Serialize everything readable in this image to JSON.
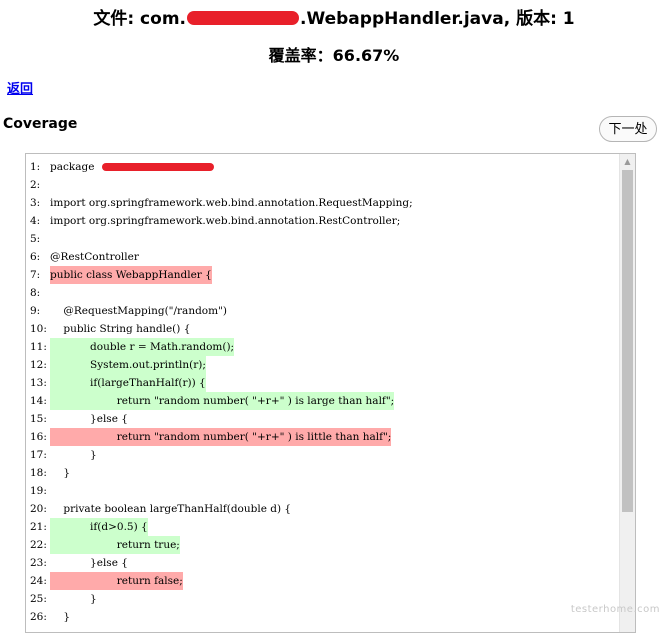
{
  "header": {
    "title_prefix": "文件: com.",
    "title_suffix": ".WebappHandler.java, 版本: 1",
    "coverage_text": "覆盖率：66.67%"
  },
  "nav": {
    "back_label": "返回"
  },
  "section": {
    "label": "Coverage"
  },
  "toolbar": {
    "next_label": "下一处"
  },
  "colors": {
    "hit": "#ccffcc",
    "miss": "#ffaaaa",
    "redaction": "#e8202a",
    "link": "#0000ee"
  },
  "code_lines": [
    {
      "num": "1:",
      "text": "package ",
      "status": "none",
      "redacted": true
    },
    {
      "num": "2:",
      "text": "",
      "status": "none"
    },
    {
      "num": "3:",
      "text": "import org.springframework.web.bind.annotation.RequestMapping;",
      "status": "none"
    },
    {
      "num": "4:",
      "text": "import org.springframework.web.bind.annotation.RestController;",
      "status": "none"
    },
    {
      "num": "5:",
      "text": "",
      "status": "none"
    },
    {
      "num": "6:",
      "text": "@RestController",
      "status": "none"
    },
    {
      "num": "7:",
      "text": "public class WebappHandler {",
      "status": "miss"
    },
    {
      "num": "8:",
      "text": "",
      "status": "none"
    },
    {
      "num": "9:",
      "text": "    @RequestMapping(\"/random\")",
      "status": "none"
    },
    {
      "num": "10:",
      "text": "    public String handle() {",
      "status": "none"
    },
    {
      "num": "11:",
      "text": "            double r = Math.random();",
      "status": "hit"
    },
    {
      "num": "12:",
      "text": "            System.out.println(r);",
      "status": "hit"
    },
    {
      "num": "13:",
      "text": "            if(largeThanHalf(r)) {",
      "status": "hit"
    },
    {
      "num": "14:",
      "text": "                    return \"random number( \"+r+\" ) is large than half\";",
      "status": "hit"
    },
    {
      "num": "15:",
      "text": "            }else {",
      "status": "none"
    },
    {
      "num": "16:",
      "text": "                    return \"random number( \"+r+\" ) is little than half\";",
      "status": "miss"
    },
    {
      "num": "17:",
      "text": "            }",
      "status": "none"
    },
    {
      "num": "18:",
      "text": "    }",
      "status": "none"
    },
    {
      "num": "19:",
      "text": "",
      "status": "none"
    },
    {
      "num": "20:",
      "text": "    private boolean largeThanHalf(double d) {",
      "status": "none"
    },
    {
      "num": "21:",
      "text": "            if(d>0.5) {",
      "status": "hit"
    },
    {
      "num": "22:",
      "text": "                    return true;",
      "status": "hit"
    },
    {
      "num": "23:",
      "text": "            }else {",
      "status": "none"
    },
    {
      "num": "24:",
      "text": "                    return false;",
      "status": "miss"
    },
    {
      "num": "25:",
      "text": "            }",
      "status": "none"
    },
    {
      "num": "26:",
      "text": "    }",
      "status": "none"
    }
  ],
  "scrollbar": {
    "up_icon": "▲"
  },
  "watermark": "testerhome.com"
}
